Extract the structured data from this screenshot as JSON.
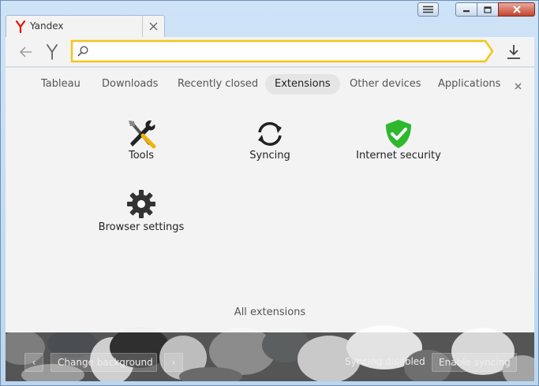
{
  "window": {
    "tab_title": "Yandex",
    "colors": {
      "brand": "#e61400",
      "accent": "#ffcc00",
      "security": "#2eb82e"
    }
  },
  "toolbar": {
    "search_value": "",
    "search_placeholder": ""
  },
  "nav": {
    "items": [
      {
        "label": "Tableau"
      },
      {
        "label": "Downloads"
      },
      {
        "label": "Recently closed"
      },
      {
        "label": "Extensions",
        "active": true
      },
      {
        "label": "Other devices"
      },
      {
        "label": "Applications"
      }
    ]
  },
  "extensions": {
    "tiles": [
      {
        "label": "Tools",
        "icon": "tools-icon"
      },
      {
        "label": "Syncing",
        "icon": "sync-icon"
      },
      {
        "label": "Internet security",
        "icon": "shield-check-icon"
      },
      {
        "label": "Browser settings",
        "icon": "gear-icon"
      }
    ],
    "all_label": "All extensions"
  },
  "bottom": {
    "prev_label": "‹",
    "change_background_label": "Change background",
    "next_label": "›",
    "sync_status": "Syncing disabled",
    "enable_sync_label": "Enable syncing"
  }
}
